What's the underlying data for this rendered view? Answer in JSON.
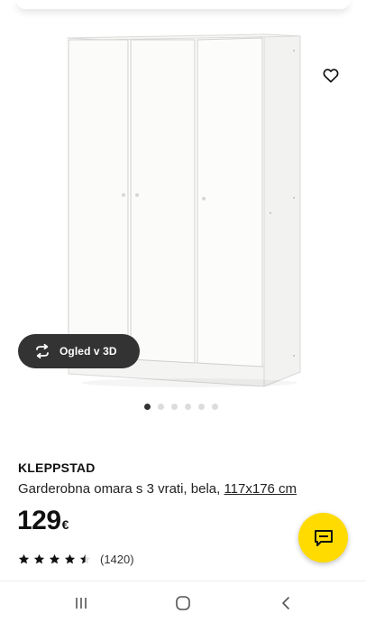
{
  "product": {
    "name": "KLEPPSTAD",
    "description_prefix": "Garderobna omara s 3 vrati, bela, ",
    "measure": "117x176 cm",
    "price": "129",
    "currency": "€",
    "rating": 4.5,
    "review_count": "(1420)"
  },
  "gallery": {
    "view3d_label": "Ogled v 3D",
    "image_count": 6,
    "active_index": 0
  },
  "icons": {
    "favorite": "heart-outline-icon",
    "view3d": "rotate-3d-icon",
    "chat": "chat-bubble-icon",
    "nav_recents": "recents-icon",
    "nav_home": "home-icon",
    "nav_back": "back-icon"
  },
  "colors": {
    "accent_yellow": "#ffdb00",
    "dark_pill": "#333333",
    "text": "#111111"
  }
}
